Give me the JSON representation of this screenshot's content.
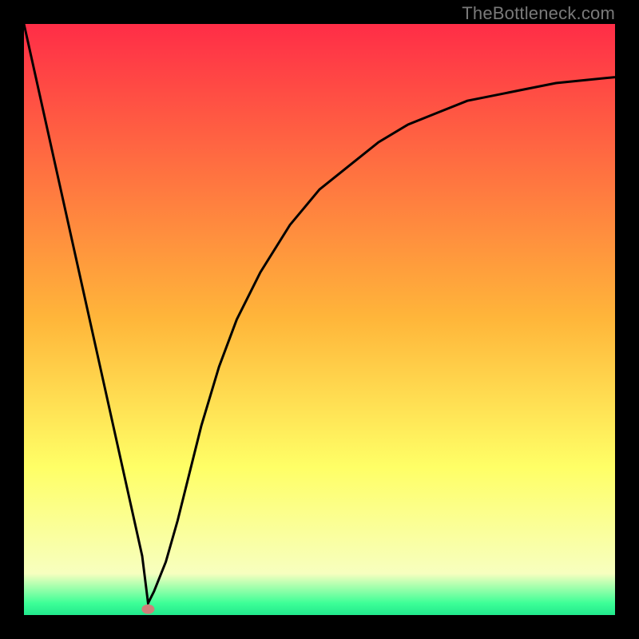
{
  "attribution": "TheBottleneck.com",
  "chart_data": {
    "type": "line",
    "title": "",
    "xlabel": "",
    "ylabel": "",
    "xlim": [
      0,
      100
    ],
    "ylim": [
      0,
      100
    ],
    "grid": false,
    "background_gradient": {
      "stops": [
        {
          "pos": 0.0,
          "color": "#ff2d47"
        },
        {
          "pos": 0.5,
          "color": "#ffb63a"
        },
        {
          "pos": 0.75,
          "color": "#ffff66"
        },
        {
          "pos": 0.93,
          "color": "#f7ffbf"
        },
        {
          "pos": 0.98,
          "color": "#3dff97"
        },
        {
          "pos": 1.0,
          "color": "#22e88d"
        }
      ]
    },
    "series": [
      {
        "name": "bottleneck-curve",
        "color": "#000000",
        "x": [
          0,
          2,
          4,
          6,
          8,
          10,
          12,
          14,
          16,
          18,
          20,
          21,
          22,
          24,
          26,
          28,
          30,
          33,
          36,
          40,
          45,
          50,
          55,
          60,
          65,
          70,
          75,
          80,
          85,
          90,
          95,
          100
        ],
        "y": [
          100,
          91,
          82,
          73,
          64,
          55,
          46,
          37,
          28,
          19,
          10,
          2,
          4,
          9,
          16,
          24,
          32,
          42,
          50,
          58,
          66,
          72,
          76,
          80,
          83,
          85,
          87,
          88,
          89,
          90,
          90.5,
          91
        ]
      }
    ],
    "marker": {
      "name": "bottleneck-point",
      "x": 21,
      "y": 1,
      "color": "#cf7f7a",
      "rx": 8,
      "ry": 6
    }
  }
}
